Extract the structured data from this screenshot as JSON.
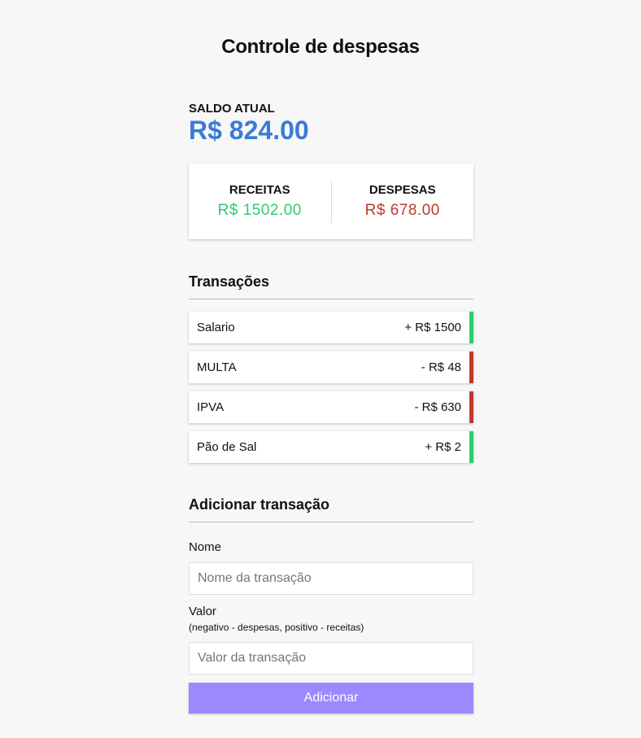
{
  "header": {
    "title": "Controle de despesas"
  },
  "balance": {
    "label": "SALDO ATUAL",
    "value": "R$ 824.00"
  },
  "summary": {
    "income_label": "RECEITAS",
    "income_value": "R$ 1502.00",
    "expense_label": "DESPESAS",
    "expense_value": "R$ 678.00"
  },
  "transactions": {
    "title": "Transações",
    "items": [
      {
        "name": "Salario",
        "amount": "+ R$ 1500",
        "type": "income"
      },
      {
        "name": "MULTA",
        "amount": "- R$ 48",
        "type": "expense"
      },
      {
        "name": "IPVA",
        "amount": "- R$ 630",
        "type": "expense"
      },
      {
        "name": "Pão de Sal",
        "amount": "+ R$ 2",
        "type": "income"
      }
    ]
  },
  "form": {
    "title": "Adicionar transação",
    "name_label": "Nome",
    "name_placeholder": "Nome da transação",
    "value_label": "Valor",
    "value_hint": "(negativo - despesas, positivo - receitas)",
    "value_placeholder": "Valor da transação",
    "submit_label": "Adicionar"
  },
  "colors": {
    "balance": "#3a7bd5",
    "income": "#2ecc71",
    "expense": "#c0392b",
    "button": "#9c88ff"
  }
}
